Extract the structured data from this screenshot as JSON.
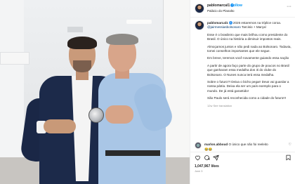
{
  "post": {
    "username": "pablomarcal1",
    "follow_label": "Follow",
    "location": "Palácio do Planalto",
    "caption": {
      "username": "pablomarcal1",
      "line1": "2026 estaremos na tríplice coroa.",
      "mentions": "@jairmessiasbolsonaro",
      "tags": "Tarcisio + Marçal",
      "p1": "Esse é o brasileiro que mais brilhou como presidente do Brasil. O único na história a diminuir impostos reais.",
      "p2": "Almoçamos juntos e não pedi nada ao Bolsonaro. Todavia, tomei conselhos importantes que ele segue.",
      "p3": "Em breve, teremos você novamente guiando essa nação",
      "p4": "A partir de agora faço parte do grupo de poucos no Brasil que ganharam essa medalha dos 3i do clube do Bolsonaro. O Nunes nunca terá essa medalha.",
      "p5": "Sobre o futuro?! Deixa o bicho pegar! Deus vai guardar a nossa pátria. Deixa ela ser um país exemplo para o mundo. De já está garantido!",
      "p6": "São Paulo será reconhecida como a cidade do futuro!!!",
      "timestamp": "12w  See translation"
    },
    "comment": {
      "username": "marlon.abboud",
      "text": "O único que não foi reeleito",
      "emoji": "😂😂"
    },
    "likes": "1,047,967 likes",
    "date": "June 3"
  },
  "icons": {
    "like": "heart-icon",
    "comment": "comment-icon",
    "share": "share-icon",
    "save": "bookmark-icon",
    "more": "more-options-icon"
  },
  "colors": {
    "link": "#0095f6",
    "verified": "#3897f0",
    "text": "#262626",
    "muted": "#8e8e8e"
  }
}
